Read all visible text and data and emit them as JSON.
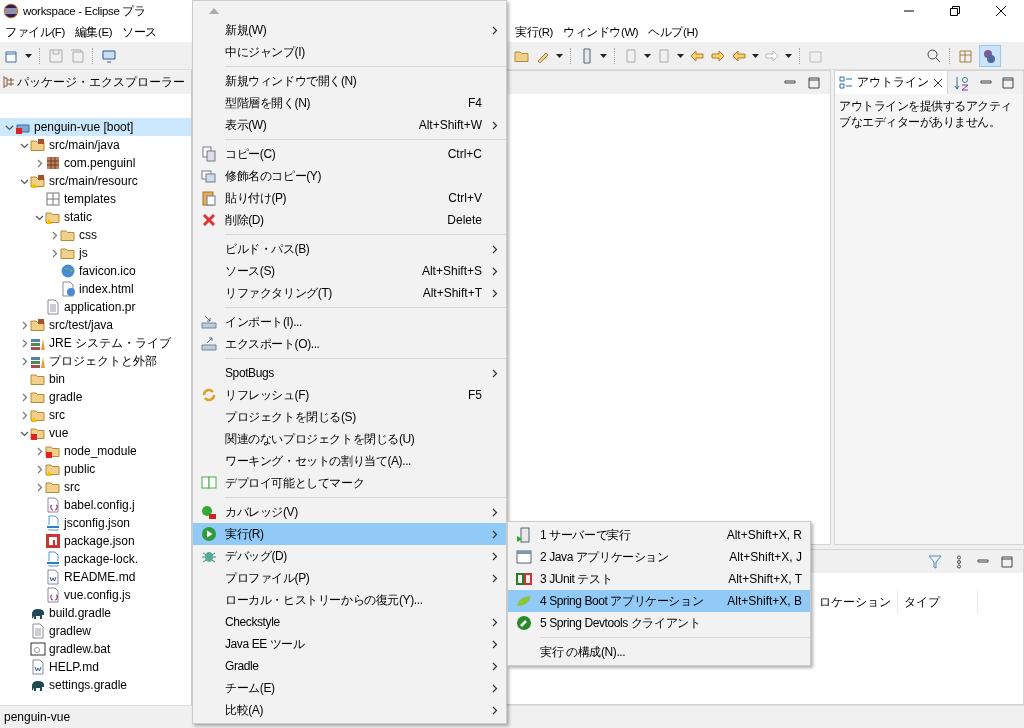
{
  "window": {
    "title": "workspace - Eclipse プラ"
  },
  "menu_bar": {
    "left": [
      {
        "label": "ファイル(F)"
      },
      {
        "label": "編集(E)"
      },
      {
        "label": "ソース"
      }
    ],
    "right": [
      {
        "label": "実行(R)"
      },
      {
        "label": "ウィンドウ(W)"
      },
      {
        "label": "ヘルプ(H)"
      }
    ]
  },
  "package_explorer": {
    "title": "パッケージ・エクスプローラー",
    "tree": [
      {
        "label": "penguin-vue [boot]",
        "kind": "project",
        "expanded": true,
        "selected": true,
        "children": [
          {
            "label": "src/main/java",
            "kind": "src-folder",
            "expanded": true,
            "selected": false,
            "children": [
              {
                "label": "com.penguinl",
                "kind": "package",
                "expanded": false,
                "selected": false
              }
            ]
          },
          {
            "label": "src/main/resourc",
            "kind": "src-folder-warn",
            "expanded": true,
            "selected": false,
            "children": [
              {
                "label": "templates",
                "kind": "package-empty",
                "selected": false
              },
              {
                "label": "static",
                "kind": "folder-warn",
                "expanded": true,
                "selected": false,
                "children": [
                  {
                    "label": "css",
                    "kind": "folder",
                    "expanded": false,
                    "selected": false
                  },
                  {
                    "label": "js",
                    "kind": "folder",
                    "expanded": false,
                    "selected": false
                  },
                  {
                    "label": "favicon.ico",
                    "kind": "globe",
                    "selected": false
                  },
                  {
                    "label": "index.html",
                    "kind": "html",
                    "selected": false
                  }
                ]
              },
              {
                "label": "application.pr",
                "kind": "text",
                "selected": false
              }
            ]
          },
          {
            "label": "src/test/java",
            "kind": "src-folder",
            "expanded": false,
            "selected": false
          },
          {
            "label": "JRE システム・ライブ",
            "kind": "library",
            "expanded": false,
            "selected": false
          },
          {
            "label": "プロジェクトと外部",
            "kind": "library",
            "expanded": false,
            "selected": false
          },
          {
            "label": "bin",
            "kind": "folder",
            "selected": false
          },
          {
            "label": "gradle",
            "kind": "folder",
            "expanded": false,
            "selected": false
          },
          {
            "label": "src",
            "kind": "folder-warn",
            "expanded": false,
            "selected": false
          },
          {
            "label": "vue",
            "kind": "folder-error",
            "expanded": true,
            "selected": false,
            "children": [
              {
                "label": "node_module",
                "kind": "folder-error",
                "expanded": false,
                "selected": false
              },
              {
                "label": "public",
                "kind": "folder-warn",
                "expanded": false,
                "selected": false
              },
              {
                "label": "src",
                "kind": "folder",
                "expanded": false,
                "selected": false
              },
              {
                "label": "babel.config.j",
                "kind": "brace",
                "selected": false
              },
              {
                "label": "jsconfig.json",
                "kind": "json",
                "selected": false
              },
              {
                "label": "package.json",
                "kind": "npm",
                "selected": false
              },
              {
                "label": "package-lock.",
                "kind": "json",
                "selected": false
              },
              {
                "label": "README.md",
                "kind": "doc",
                "selected": false
              },
              {
                "label": "vue.config.js",
                "kind": "brace",
                "selected": false
              }
            ]
          },
          {
            "label": "build.gradle",
            "kind": "elephant",
            "selected": false
          },
          {
            "label": "gradlew",
            "kind": "text",
            "selected": false
          },
          {
            "label": "gradlew.bat",
            "kind": "bat",
            "selected": false
          },
          {
            "label": "HELP.md",
            "kind": "doc",
            "selected": false
          },
          {
            "label": "settings.gradle",
            "kind": "elephant",
            "selected": false
          }
        ]
      }
    ]
  },
  "outline": {
    "title": "アウトライン",
    "message": "アウトラインを提供するアクティブなエディターがありません。"
  },
  "bottom_panel": {
    "columns": [
      "ロケーション",
      "タイプ"
    ]
  },
  "status_bar": {
    "text": "penguin-vue"
  },
  "context_menu": {
    "items": [
      {
        "kind": "item",
        "label": "新規(W)",
        "submenu": true,
        "selected": false
      },
      {
        "kind": "item",
        "label": "中にジャンプ(I)",
        "submenu": false,
        "selected": false
      },
      {
        "kind": "separator"
      },
      {
        "kind": "item",
        "label": "新規ウィンドウで開く(N)",
        "submenu": false,
        "selected": false
      },
      {
        "kind": "item",
        "label": "型階層を開く(N)",
        "shortcut": "F4",
        "submenu": false,
        "selected": false
      },
      {
        "kind": "item",
        "label": "表示(W)",
        "shortcut": "Alt+Shift+W",
        "submenu": true,
        "selected": false
      },
      {
        "kind": "separator"
      },
      {
        "kind": "copy",
        "label": "コピー(C)",
        "shortcut": "Ctrl+C",
        "submenu": false,
        "selected": false
      },
      {
        "kind": "copy2",
        "label": "修飾名のコピー(Y)",
        "submenu": false,
        "selected": false
      },
      {
        "kind": "paste",
        "label": "貼り付け(P)",
        "shortcut": "Ctrl+V",
        "submenu": false,
        "selected": false
      },
      {
        "kind": "delete",
        "label": "削除(D)",
        "shortcut": "Delete",
        "submenu": false,
        "selected": false
      },
      {
        "kind": "separator"
      },
      {
        "kind": "item",
        "label": "ビルド・パス(B)",
        "submenu": true,
        "selected": false
      },
      {
        "kind": "item",
        "label": "ソース(S)",
        "shortcut": "Alt+Shift+S",
        "submenu": true,
        "selected": false
      },
      {
        "kind": "item",
        "label": "リファクタリング(T)",
        "shortcut": "Alt+Shift+T",
        "submenu": true,
        "selected": false
      },
      {
        "kind": "separator"
      },
      {
        "kind": "import",
        "label": "インポート(I)...",
        "submenu": false,
        "selected": false
      },
      {
        "kind": "export",
        "label": "エクスポート(O)...",
        "submenu": false,
        "selected": false
      },
      {
        "kind": "separator"
      },
      {
        "kind": "item",
        "label": "SpotBugs",
        "submenu": true,
        "selected": false
      },
      {
        "kind": "refresh",
        "label": "リフレッシュ(F)",
        "shortcut": "F5",
        "submenu": false,
        "selected": false
      },
      {
        "kind": "item",
        "label": "プロジェクトを閉じる(S)",
        "submenu": false,
        "selected": false
      },
      {
        "kind": "item",
        "label": "関連のないプロジェクトを閉じる(U)",
        "submenu": false,
        "selected": false
      },
      {
        "kind": "item",
        "label": "ワーキング・セットの割り当て(A)...",
        "submenu": false,
        "selected": false
      },
      {
        "kind": "deploy",
        "label": "デプロイ可能としてマーク",
        "submenu": false,
        "selected": false
      },
      {
        "kind": "separator"
      },
      {
        "kind": "coverage",
        "label": "カバレッジ(V)",
        "submenu": true,
        "selected": false
      },
      {
        "kind": "run",
        "label": "実行(R)",
        "submenu": true,
        "selected": true
      },
      {
        "kind": "bug",
        "label": "デバッグ(D)",
        "submenu": true,
        "selected": false
      },
      {
        "kind": "item",
        "label": "プロファイル(P)",
        "submenu": true,
        "selected": false
      },
      {
        "kind": "item",
        "label": "ローカル・ヒストリーからの復元(Y)...",
        "submenu": false,
        "selected": false
      },
      {
        "kind": "item",
        "label": "Checkstyle",
        "submenu": true,
        "selected": false
      },
      {
        "kind": "item",
        "label": "Java EE ツール",
        "submenu": true,
        "selected": false
      },
      {
        "kind": "item",
        "label": "Gradle",
        "submenu": true,
        "selected": false
      },
      {
        "kind": "item",
        "label": "チーム(E)",
        "submenu": true,
        "selected": false
      },
      {
        "kind": "item",
        "label": "比較(A)",
        "submenu": true,
        "selected": false
      }
    ]
  },
  "submenu": {
    "items": [
      {
        "kind": "server",
        "label": "1 サーバーで実行",
        "shortcut": "Alt+Shift+X, R",
        "selected": false
      },
      {
        "kind": "java-app",
        "label": "2 Java アプリケーション",
        "shortcut": "Alt+Shift+X, J",
        "selected": false
      },
      {
        "kind": "test",
        "label": "3 JUnit テスト",
        "shortcut": "Alt+Shift+X, T",
        "selected": false
      },
      {
        "kind": "leaf",
        "label": "4 Spring Boot アプリケーション",
        "shortcut": "Alt+Shift+X, B",
        "selected": true
      },
      {
        "kind": "wrench",
        "label": "5 Spring Devtools クライアント",
        "selected": false
      },
      {
        "kind": "separator"
      },
      {
        "kind": "item",
        "label": "実行 の構成(N)...",
        "selected": false
      }
    ]
  }
}
